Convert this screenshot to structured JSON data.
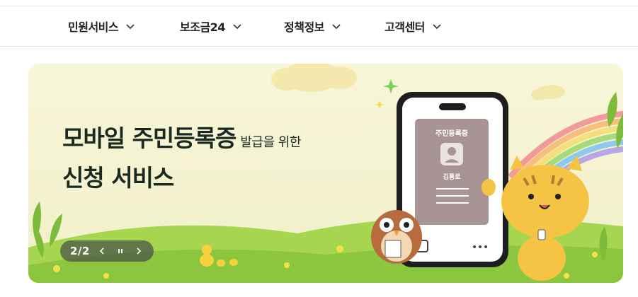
{
  "nav": {
    "items": [
      {
        "label": "민원서비스"
      },
      {
        "label": "보조금24"
      },
      {
        "label": "정책정보"
      },
      {
        "label": "고객센터"
      }
    ]
  },
  "banner": {
    "headline_main": "모바일 주민등록증",
    "headline_sub": "발급을 위한",
    "headline_line2": "신청 서비스",
    "card": {
      "title": "주민등록증",
      "name": "김통로"
    },
    "pager": "2/2",
    "controls": {
      "prev_icon": "chevron-left-icon",
      "pause_icon": "pause-icon",
      "next_icon": "chevron-right-icon"
    }
  },
  "colors": {
    "banner_bg": "#f5f3d2",
    "hill_green": "#8cc63f",
    "headline_text": "#1b2a20",
    "card_bg": "#a89494",
    "controls_bg": "#4a554a"
  }
}
